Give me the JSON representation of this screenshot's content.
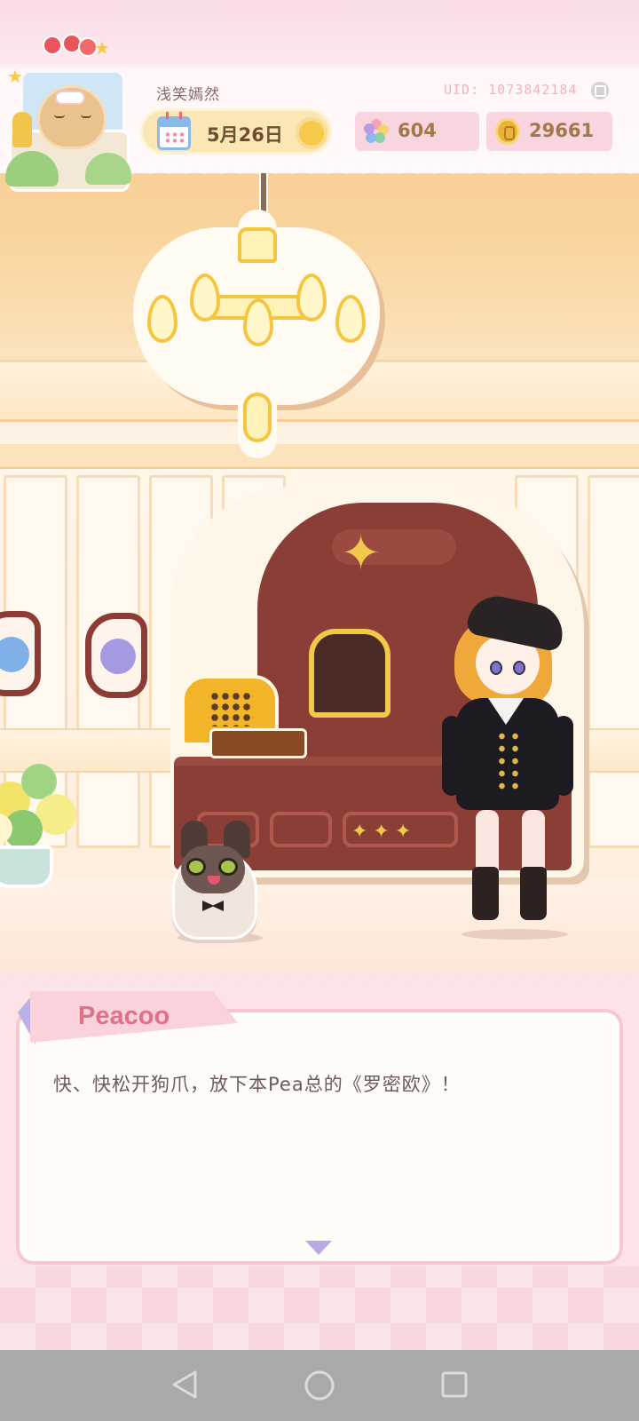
{
  "player": {
    "name": "浅笑嫣然",
    "uid": "UID: 1073842184"
  },
  "date": {
    "label": "5月26日",
    "weather_icon": "sun-icon"
  },
  "currency": {
    "gems": "604",
    "coins": "29661",
    "gem_icon": "rainbow-flower-icon",
    "coin_icon": "gold-coin-icon"
  },
  "dialog": {
    "speaker": "Peacoo",
    "text": "快、快松开狗爪，放下本Pea总的《罗密欧》！",
    "advance_icon": "triangle-down-icon"
  },
  "navbar": {
    "back_icon": "back-triangle-icon",
    "home_icon": "home-circle-icon",
    "recents_icon": "recents-square-icon"
  },
  "colors": {
    "accent_pink": "#f7c6cf",
    "speaker_name": "#e07288",
    "hud_text": "#a4774a"
  }
}
